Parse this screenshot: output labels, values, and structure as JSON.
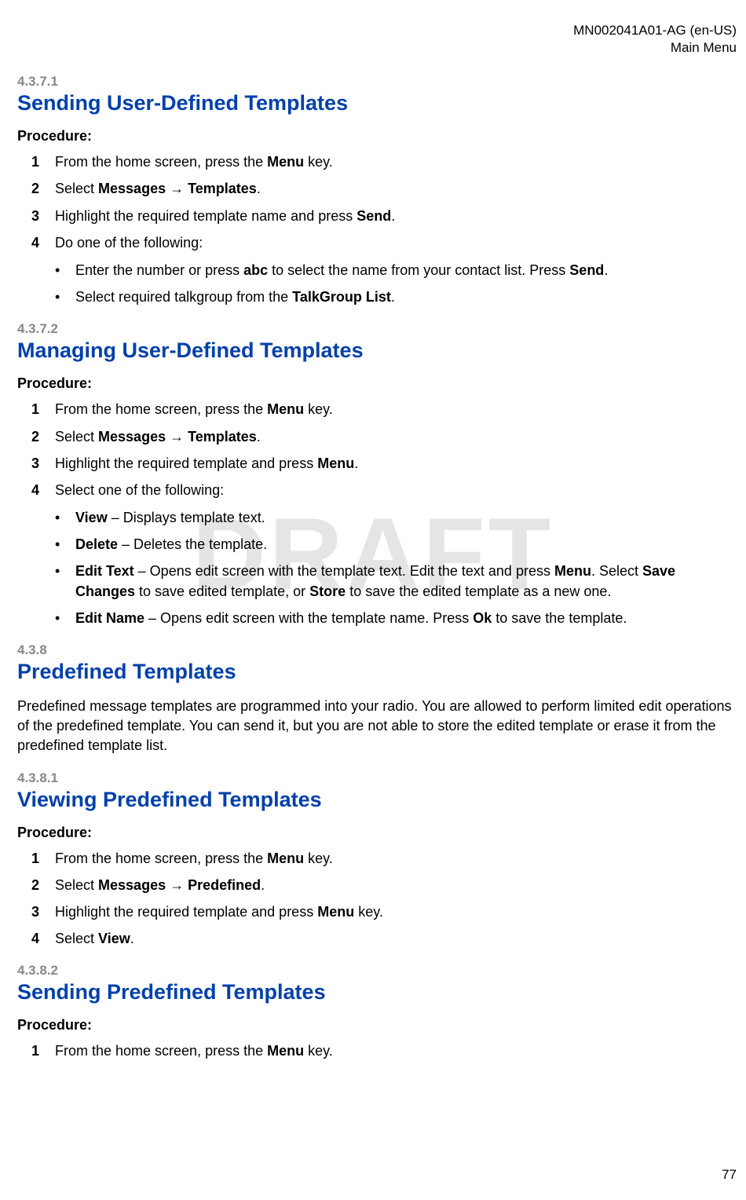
{
  "header": {
    "doc_id": "MN002041A01-AG (en-US)",
    "section": "Main Menu"
  },
  "watermark": "DRAFT",
  "page_number": "77",
  "sec_4371": {
    "num": "4.3.7.1",
    "title": "Sending User-Defined Templates",
    "procedure_label": "Procedure:",
    "step1_a": "From the home screen, press the ",
    "step1_b": "Menu",
    "step1_c": " key.",
    "step2_a": "Select ",
    "step2_b": "Messages",
    "step2_arrow": " → ",
    "step2_c": "Templates",
    "step2_d": ".",
    "step3_a": "Highlight the required template name and press ",
    "step3_b": "Send",
    "step3_c": ".",
    "step4": "Do one of the following:",
    "bullet1_a": "Enter the number or press ",
    "bullet1_b": "abc",
    "bullet1_c": " to select the name from your contact list. Press ",
    "bullet1_d": "Send",
    "bullet1_e": ".",
    "bullet2_a": "Select required talkgroup from the ",
    "bullet2_b": "TalkGroup List",
    "bullet2_c": "."
  },
  "sec_4372": {
    "num": "4.3.7.2",
    "title": "Managing User-Defined Templates",
    "procedure_label": "Procedure:",
    "step1_a": "From the home screen, press the ",
    "step1_b": "Menu",
    "step1_c": " key.",
    "step2_a": "Select ",
    "step2_b": "Messages",
    "step2_arrow": " → ",
    "step2_c": "Templates",
    "step2_d": ".",
    "step3_a": "Highlight the required template and press ",
    "step3_b": "Menu",
    "step3_c": ".",
    "step4": "Select one of the following:",
    "bullet1_a": "View",
    "bullet1_b": " – Displays template text.",
    "bullet2_a": "Delete",
    "bullet2_b": " – Deletes the template.",
    "bullet3_a": "Edit Text",
    "bullet3_b": " – Opens edit screen with the template text. Edit the text and press ",
    "bullet3_c": "Menu",
    "bullet3_d": ". Select ",
    "bullet3_e": "Save Changes",
    "bullet3_f": " to save edited template, or ",
    "bullet3_g": "Store",
    "bullet3_h": " to save the edited template as a new one.",
    "bullet4_a": "Edit Name",
    "bullet4_b": " – Opens edit screen with the template name. Press ",
    "bullet4_c": "Ok",
    "bullet4_d": " to save the template."
  },
  "sec_438": {
    "num": "4.3.8",
    "title": "Predefined Templates",
    "para": "Predefined message templates are programmed into your radio. You are allowed to perform limited edit operations of the predefined template. You can send it, but you are not able to store the edited template or erase it from the predefined template list."
  },
  "sec_4381": {
    "num": "4.3.8.1",
    "title": "Viewing Predefined Templates",
    "procedure_label": "Procedure:",
    "step1_a": "From the home screen, press the ",
    "step1_b": "Menu",
    "step1_c": " key.",
    "step2_a": "Select ",
    "step2_b": "Messages",
    "step2_arrow": " → ",
    "step2_c": "Predefined",
    "step2_d": ".",
    "step3_a": "Highlight the required template and press ",
    "step3_b": "Menu",
    "step3_c": " key.",
    "step4_a": "Select ",
    "step4_b": "View",
    "step4_c": "."
  },
  "sec_4382": {
    "num": "4.3.8.2",
    "title": "Sending Predefined Templates",
    "procedure_label": "Procedure:",
    "step1_a": "From the home screen, press the ",
    "step1_b": "Menu",
    "step1_c": " key."
  }
}
